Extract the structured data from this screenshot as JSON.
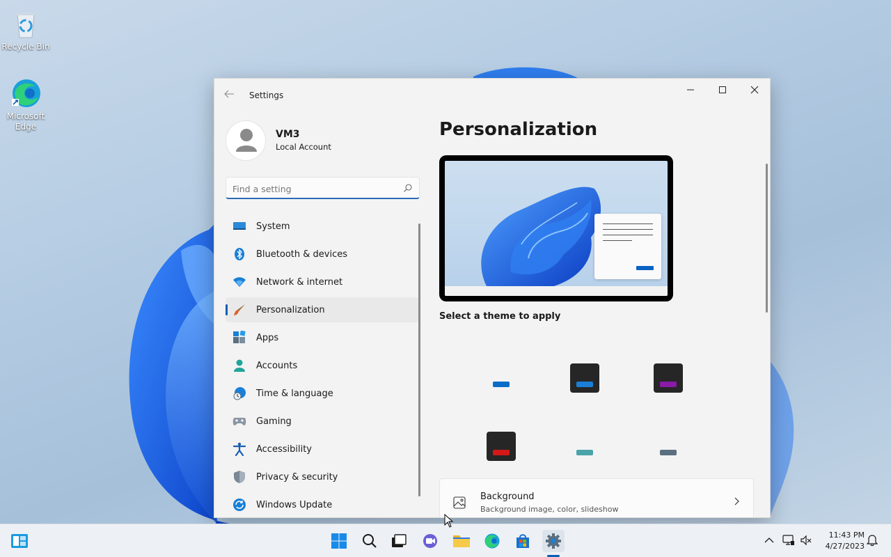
{
  "desktop": {
    "icons": [
      {
        "label": "Recycle Bin"
      },
      {
        "label": "Microsoft Edge"
      }
    ]
  },
  "window": {
    "title": "Settings",
    "profile": {
      "name": "VM3",
      "account_type": "Local Account"
    },
    "search": {
      "placeholder": "Find a setting"
    },
    "nav": [
      {
        "label": "System",
        "icon": "system-icon"
      },
      {
        "label": "Bluetooth & devices",
        "icon": "bluetooth-icon"
      },
      {
        "label": "Network & internet",
        "icon": "wifi-icon"
      },
      {
        "label": "Personalization",
        "icon": "paintbrush-icon",
        "active": true
      },
      {
        "label": "Apps",
        "icon": "apps-icon"
      },
      {
        "label": "Accounts",
        "icon": "person-icon"
      },
      {
        "label": "Time & language",
        "icon": "globe-clock-icon"
      },
      {
        "label": "Gaming",
        "icon": "gamepad-icon"
      },
      {
        "label": "Accessibility",
        "icon": "accessibility-icon"
      },
      {
        "label": "Privacy & security",
        "icon": "shield-icon"
      },
      {
        "label": "Windows Update",
        "icon": "update-icon"
      }
    ],
    "main": {
      "title": "Personalization",
      "theme_section_label": "Select a theme to apply",
      "themes": [
        {
          "tile": "#f3f3f3",
          "accent": "#0a6cc6"
        },
        {
          "tile": "#262626",
          "accent": "#1a7fd6"
        },
        {
          "tile": "#262626",
          "accent": "#8a1aa8"
        },
        {
          "tile": "#262626",
          "accent": "#d41818"
        },
        {
          "tile": "#f3f3f3",
          "accent": "#4aa3a8"
        },
        {
          "tile": "#f3f3f3",
          "accent": "#5a6f80"
        }
      ],
      "background_card": {
        "title": "Background",
        "subtitle": "Background image, color, slideshow"
      }
    }
  },
  "taskbar": {
    "clock": {
      "time": "11:43 PM",
      "date": "4/27/2023"
    }
  },
  "colors": {
    "accent": "#0a5fb4"
  }
}
